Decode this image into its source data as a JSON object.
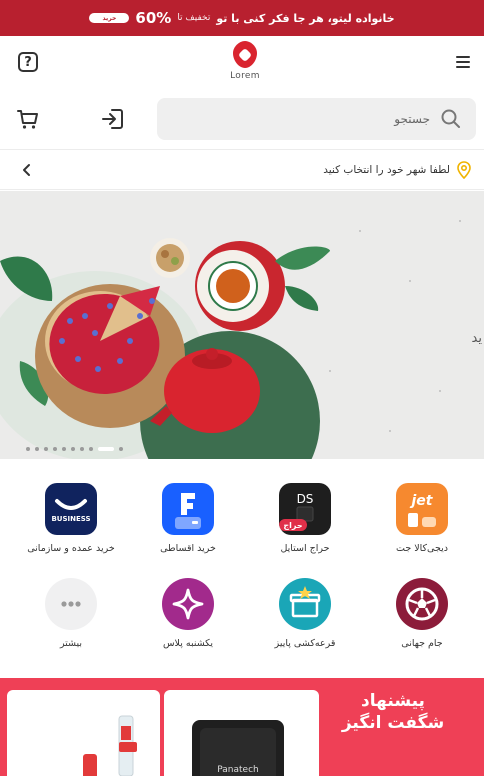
{
  "promo": {
    "headline": "خانواده لیتو، هر جا فکر کنی با تو",
    "sub": "تخفیف تا",
    "percent": "60%",
    "button": "خرید",
    "color": "#b8202f"
  },
  "header": {
    "logo_text": "Lorem",
    "help_icon": "question-icon",
    "menu_icon": "hamburger-menu-icon"
  },
  "search": {
    "placeholder": "جستجو"
  },
  "location": {
    "text": "لطفا شهر خود را انتخاب کنید"
  },
  "banner": {
    "peek_text": "ید",
    "slide_count": 11,
    "active_slide": 9
  },
  "quick_links": [
    {
      "label": "دیجی‌کالا جت",
      "icon": "jet-icon",
      "badge": "jet",
      "color": "#f6892f"
    },
    {
      "label": "حراج استایل",
      "icon": "style-sale-icon",
      "badge": "DS",
      "tag": "حراج",
      "color": "#1e1e1e"
    },
    {
      "label": "خرید اقساطی",
      "icon": "installment-icon",
      "color": "#1960ff"
    },
    {
      "label": "خرید عمده و سازمانی",
      "icon": "business-icon",
      "badge": "BUSINESS",
      "color": "#10235e"
    },
    {
      "label": "جام جهانی",
      "icon": "soccer-ball-icon",
      "color": "#8c1c3a"
    },
    {
      "label": "قرعه‌کشی پاییز",
      "icon": "gift-box-icon",
      "color": "#1aa6b7"
    },
    {
      "label": "یکشنبه پلاس",
      "icon": "sparkle-icon",
      "color": "#a22a8c"
    },
    {
      "label": "بیشتر",
      "icon": "more-dots-icon",
      "color": "#f0f0f1"
    }
  ],
  "offer": {
    "title": "پیشنهاد شگفت انگیز",
    "card_brand": "Panatech",
    "color": "#ef4056"
  }
}
